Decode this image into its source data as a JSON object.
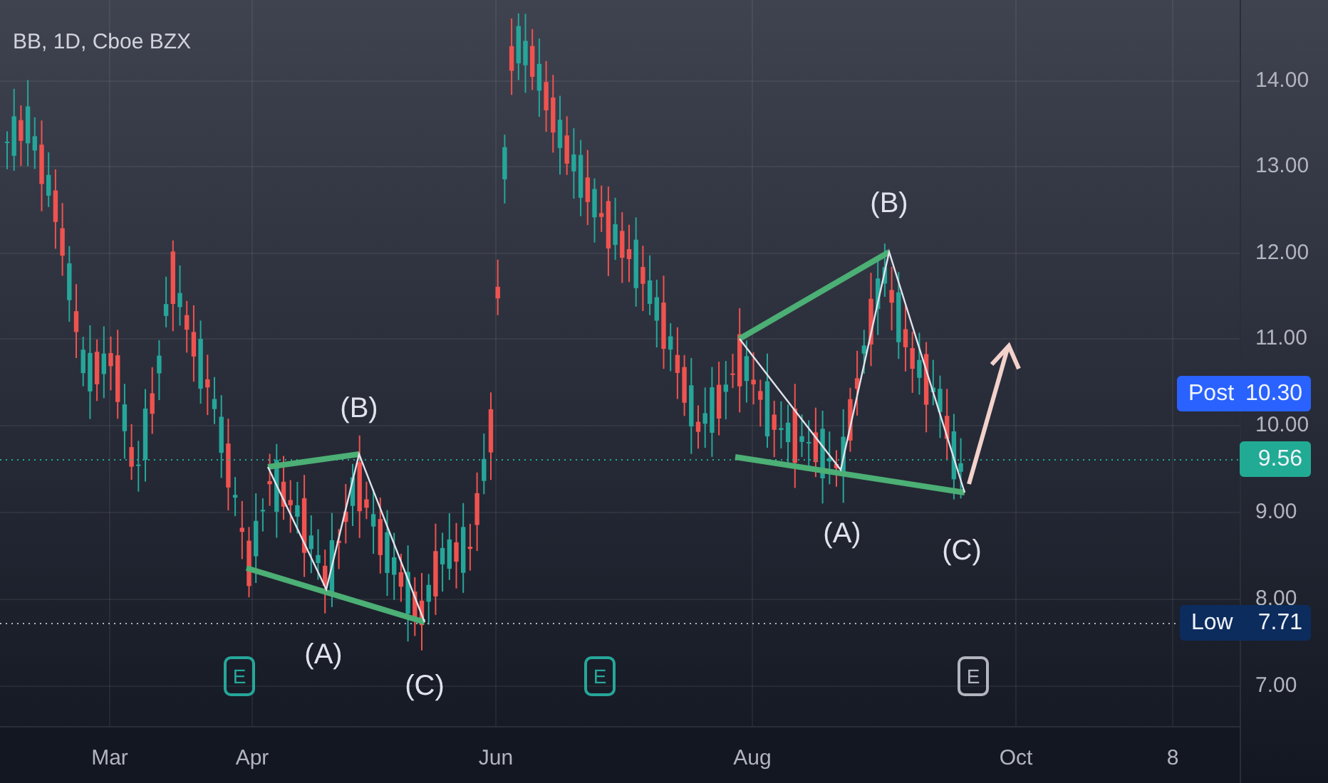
{
  "symbol_title": "BB, 1D, Cboe BZX",
  "price_axis": {
    "ticks": [
      "14.00",
      "13.00",
      "12.00",
      "11.00",
      "10.00",
      "9.00",
      "8.00",
      "7.00"
    ]
  },
  "price_badges": [
    {
      "kind": "post",
      "label": "Post",
      "value": "10.30"
    },
    {
      "kind": "last",
      "value": "9.56"
    },
    {
      "kind": "low",
      "label": "Low",
      "value": "7.71"
    }
  ],
  "time_axis": {
    "ticks": [
      "Mar",
      "Apr",
      "Jun",
      "Aug",
      "Oct",
      "8"
    ]
  },
  "wave_labels": [
    "(B)",
    "(A)",
    "(C)",
    "(B)",
    "(A)",
    "(C)"
  ],
  "earnings_markers": [
    {
      "label": "E",
      "color": "#26a69a"
    },
    {
      "label": "E",
      "color": "#26a69a"
    },
    {
      "label": "E",
      "color": "#b2b5be"
    }
  ]
}
